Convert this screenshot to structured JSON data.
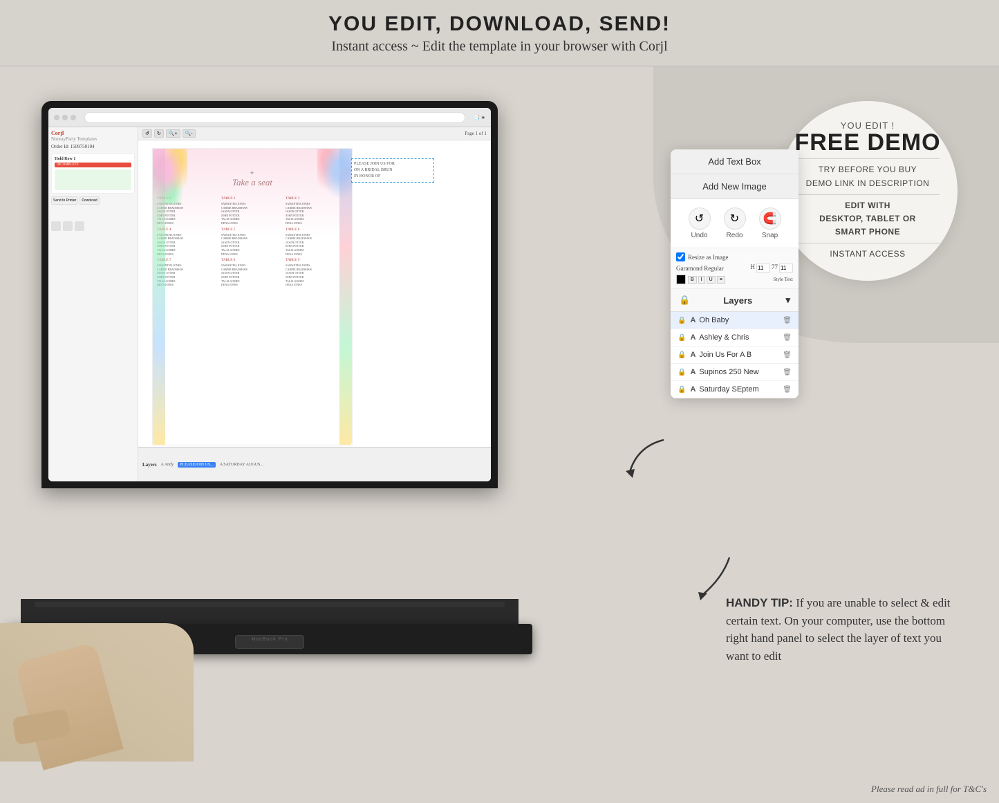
{
  "topBanner": {
    "title": "YOU EDIT, DOWNLOAD, SEND!",
    "subtitle": "Instant access ~ Edit the template in your browser with Corjl"
  },
  "freeDemoCircle": {
    "youEdit": "YOU EDIT !",
    "title": "FREE DEMO",
    "line1": "TRY BEFORE YOU BUY",
    "line2": "DEMO LINK IN DESCRIPTION",
    "divider1": "",
    "line3": "EDIT WITH",
    "line4": "DESKTOP, TABLET OR",
    "line5": "SMART PHONE",
    "divider2": "",
    "line6": "INSTANT ACCESS"
  },
  "floatingPanel": {
    "addTextBoxBtn": "Add Text Box",
    "addNewImageBtn": "Add New Image",
    "undoLabel": "Undo",
    "redoLabel": "Redo",
    "snapLabel": "Snap",
    "layersHeader": "Layers",
    "layers": [
      {
        "name": "Oh Baby",
        "active": true
      },
      {
        "name": "Ashley & Chris",
        "active": false
      },
      {
        "name": "Join Us For A B",
        "active": false
      },
      {
        "name": "Supinos 250 New",
        "active": false
      },
      {
        "name": "Saturday SEptem",
        "active": false
      }
    ]
  },
  "handyTip": {
    "label": "HANDY TIP:",
    "text": "If you are unable to select & edit certain text. On your computer, use the bottom right hand panel to select the layer of text you want to edit"
  },
  "editor": {
    "orderId": "Order Id: 1509750194",
    "holdRow": "Hold Row 1",
    "incomplete": "INCOMPLETE",
    "corjlLogo": "Corjl",
    "pageName": "NoorayParty Templates",
    "pageIndicator": "Page 1 of 1",
    "toolbar": {
      "undo": "↺",
      "redo": "↻",
      "zoom": "🔍",
      "zoomOut": "🔍"
    },
    "seatingChart": {
      "title": "Take a seat",
      "subtitle": "PLEASE JOIN US FOR A BRIDAL BRUNCH",
      "tables": [
        {
          "label": "TABLE 1",
          "names": [
            "SAMANTHA JONES",
            "CARRIE BRADSHAW",
            "JASON OTTER",
            "JOHN POTTER",
            "TALIA GOMEZ",
            "DENA JONES"
          ]
        },
        {
          "label": "TABLE 2",
          "names": [
            "SAMANTHA JONES",
            "CARRIE BRADSHAW",
            "JASON OTTER",
            "JOHN POTTER",
            "TALIA GOMEZ",
            "DENA JONES"
          ]
        },
        {
          "label": "TABLE 3",
          "names": [
            "SAMANTHA JONES",
            "CARRIE BRADSHAW",
            "JASON OTTER",
            "JOHN POTTER",
            "TALIA GOMEZ",
            "DENA JONES"
          ]
        },
        {
          "label": "TABLE 4",
          "names": [
            "SAMANTHA JONES",
            "CARRIE BRADSHAW",
            "JASON OTTER",
            "JOHN POTTER",
            "TALIA GOMEZ",
            "DENA JONES"
          ]
        },
        {
          "label": "TABLE 5",
          "names": [
            "SAMANTHA JONES",
            "CARRIE BRADSHAW",
            "JASON OTTER",
            "JOHN POTTER",
            "TALIA GOMEZ",
            "DENA JONES"
          ]
        },
        {
          "label": "TABLE 6",
          "names": [
            "SAMANTHA JONES",
            "CARRIE BRADSHAW",
            "JASON OTTER",
            "JOHN POTTER",
            "TALIA GOMEZ",
            "DENA JONES"
          ]
        },
        {
          "label": "TABLE 7",
          "names": [
            "SAMANTHA JONES",
            "CARRIE BRADSHAW",
            "JASON OTTER",
            "JOHN POTTER",
            "TALIA GOMEZ",
            "DENA JONES"
          ]
        },
        {
          "label": "TABLE 8",
          "names": [
            "SAMANTHA JONES",
            "CARRIE BRADSHAW",
            "JASON OTTER",
            "JOHN POTTER",
            "TALIA GOMEZ",
            "DENA JONES"
          ]
        },
        {
          "label": "TABLE 9",
          "names": [
            "SAMANTHA JONES",
            "CARRIE BRADSHAW",
            "JASON OTTER",
            "JOHN POTTER",
            "TALIA GOMEZ",
            "DENA JONES"
          ]
        }
      ]
    }
  },
  "tcNote": "Please read ad in full for T&C's"
}
